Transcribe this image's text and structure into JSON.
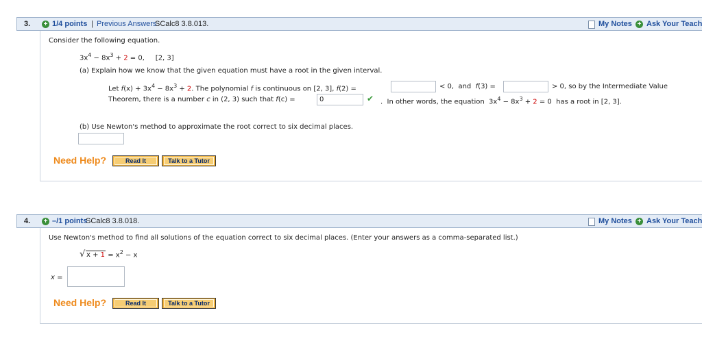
{
  "q3": {
    "number": "3.",
    "points": "1/4 points",
    "sep": "|",
    "prev_answers": "Previous Answers",
    "code": "SCalc8 3.8.013.",
    "my_notes": "My Notes",
    "ask_teacher": "Ask Your Teacher",
    "intro": "Consider the following equation.",
    "eq_a": "3x",
    "eq_exp4": "4",
    "eq_b": " − 8x",
    "eq_exp3": "3",
    "eq_c": " + ",
    "eq_two": "2",
    "eq_d": " = 0,     [2, 3]",
    "part_a": "(a) Explain how we know that the given equation must have a root in the given interval.",
    "let_1": "Let ",
    "let_fx": "f",
    "let_2": "(x) + 3x",
    "let_exp4": "4",
    "let_3": " − 8x",
    "let_exp3": "3",
    "let_4": " + ",
    "let_two": "2",
    "let_5": ". The polynomial ",
    "let_f": "f",
    "let_6": " is continuous on [2, 3], ",
    "let_f2": "f",
    "let_7": "(2) =",
    "lt_zero": "< 0,  and  ",
    "f3_f": "f",
    "f3_rest": "(3) =",
    "gt_zero": "> 0,  so by the Intermediate Value",
    "thm_1": "Theorem, there is a number ",
    "thm_c": "c",
    "thm_2": " in (2, 3) such that ",
    "thm_fc": "f",
    "thm_3": "(c) =",
    "fc_value": "0",
    "other_1": ".  In other words, the equation  3x",
    "other_exp4": "4",
    "other_2": " − 8x",
    "other_exp3": "3",
    "other_3": " + ",
    "other_two": "2",
    "other_4": " = 0  has a root in [2, 3].",
    "part_b": "(b) Use Newton's method to approximate the root correct to six decimal places.",
    "need_help": "Need Help?",
    "read_it": "Read It",
    "talk_tutor": "Talk to a Tutor"
  },
  "q4": {
    "number": "4.",
    "points": "–/1 points",
    "code": "SCalc8 3.8.018.",
    "my_notes": "My Notes",
    "ask_teacher": "Ask Your Teacher",
    "intro": "Use Newton's method to find all solutions of the equation correct to six decimal places. (Enter your answers as a comma-separated list.)",
    "rad_1": "x + ",
    "rad_one": "1",
    "eq_rest": " = x",
    "eq_exp2": "2",
    "eq_tail": " − x",
    "x_label": "x =",
    "need_help": "Need Help?",
    "read_it": "Read It",
    "talk_tutor": "Talk to a Tutor"
  },
  "colors": {
    "accent_blue": "#1f4e9c",
    "help_orange": "#ee8a1c",
    "red_coef": "#cc0000",
    "correct_green": "#3a9a3a"
  }
}
